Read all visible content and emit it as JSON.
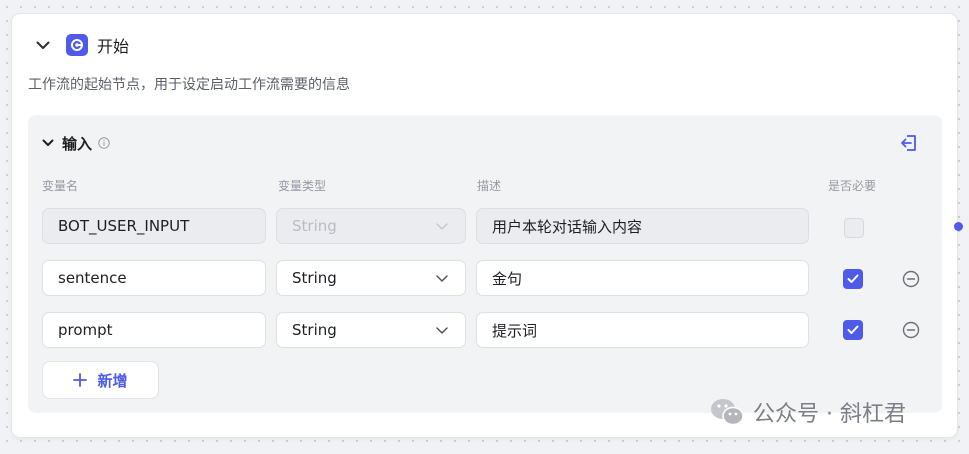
{
  "node": {
    "title": "开始",
    "description": "工作流的起始节点，用于设定启动工作流需要的信息"
  },
  "input_panel": {
    "title": "输入",
    "columns": {
      "name": "变量名",
      "type": "变量类型",
      "desc": "描述",
      "required": "是否必要"
    },
    "rows": [
      {
        "name": "BOT_USER_INPUT",
        "type": "String",
        "desc": "用户本轮对话输入内容",
        "required": false,
        "disabled": true
      },
      {
        "name": "sentence",
        "type": "String",
        "desc": "金句",
        "required": true,
        "disabled": false
      },
      {
        "name": "prompt",
        "type": "String",
        "desc": "提示词",
        "required": true,
        "disabled": false
      }
    ],
    "add_label": "新增"
  },
  "watermark": "公众号 · 斜杠君",
  "colors": {
    "accent": "#4e5ae8"
  }
}
